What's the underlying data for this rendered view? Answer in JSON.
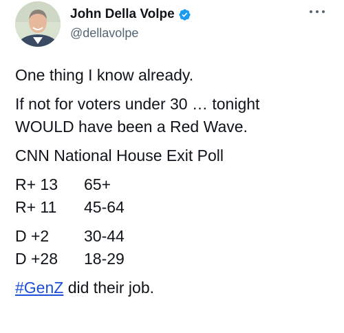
{
  "author": {
    "name": "John Della Volpe",
    "handle": "@dellavolpe",
    "verified_icon": "verified-badge-icon",
    "accent": "#1d9bf0"
  },
  "more_icon": "more-options-icon",
  "tweet": {
    "line1": "One thing I know already.",
    "line2a": "If not for voters under 30 … tonight",
    "line2b": "WOULD have been a Red Wave.",
    "line3": "CNN National House Exit Poll",
    "poll": [
      {
        "margin": "R+ 13",
        "age": "65+"
      },
      {
        "margin": "R+ 11",
        "age": "45-64"
      },
      {
        "margin": "D +2",
        "age": "30-44"
      },
      {
        "margin": "D +28",
        "age": "18-29"
      }
    ],
    "hashtag": "#GenZ",
    "closing": " did their job."
  }
}
